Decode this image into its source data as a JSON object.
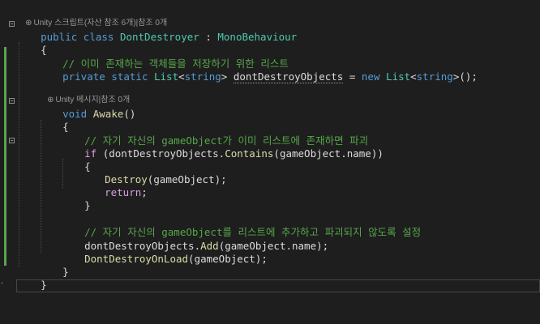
{
  "codelens": {
    "class_lens": "Unity 스크립트(자산 참조 6개)|참조 0개",
    "method_lens": "Unity 메시지|참조 0개"
  },
  "code": {
    "class_decl": {
      "kw": "public class ",
      "name": "DontDestroyer",
      "sep": " : ",
      "base": "MonoBehaviour"
    },
    "open_brace_1": "{",
    "comment_1": "// 이미 존재하는 객체들을 저장하기 위한 리스트",
    "field_decl": {
      "kw": "private static ",
      "type": "List",
      "lt": "<",
      "generic": "string",
      "gt": "> ",
      "name": "dontDestroyObjects",
      "assign": " = ",
      "new_kw": "new ",
      "type2": "List",
      "lt2": "<",
      "generic2": "string",
      "gt2": ">();"
    },
    "method_decl": {
      "kw": "void ",
      "name": "Awake",
      "parens": "()"
    },
    "open_brace_2": "{",
    "comment_2": "// 자기 자신의 gameObject가 이미 리스트에 존재하면 파괴",
    "if_line": {
      "kw": "if ",
      "p1": "(dontDestroyObjects.",
      "fn": "Contains",
      "p2": "(gameObject.name))"
    },
    "open_brace_3": "{",
    "destroy_line": {
      "fn": "Destroy",
      "args": "(gameObject);"
    },
    "return_line": {
      "kw": "return",
      "semi": ";"
    },
    "close_brace_3": "}",
    "comment_3": "// 자기 자신의 gameObject를 리스트에 추가하고 파괴되지 않도록 설정",
    "add_line": {
      "p1": "dontDestroyObjects.",
      "fn": "Add",
      "p2": "(gameObject.name);"
    },
    "ddol_line": {
      "fn": "DontDestroyOnLoad",
      "args": "(gameObject);"
    },
    "close_brace_2": "}",
    "close_brace_1": "}"
  },
  "icons": {
    "lens_icon": "codelens-reference-icon",
    "fold_icon": "fold-collapse-icon"
  },
  "colors": {
    "background": "#1e1e1e",
    "keyword": "#569cd6",
    "type": "#4ec9b0",
    "comment": "#57a64a",
    "method": "#dcdcaa",
    "control": "#d8a0df",
    "text": "#dcdcdc",
    "change_bar": "#57a64a"
  }
}
